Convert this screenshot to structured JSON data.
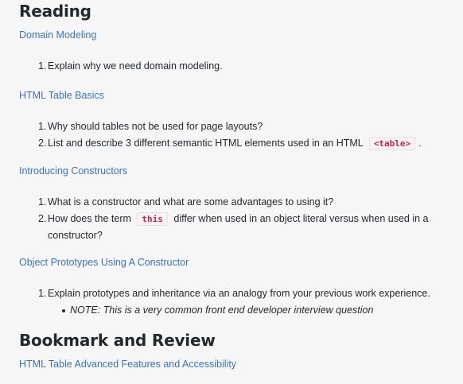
{
  "headings": {
    "reading": "Reading",
    "bookmark": "Bookmark and Review"
  },
  "sections": [
    {
      "link": "Domain Modeling",
      "items": [
        {
          "num": "1.",
          "text": "Explain why we need domain modeling."
        }
      ]
    },
    {
      "link": "HTML Table Basics",
      "items": [
        {
          "num": "1.",
          "text": "Why should tables not be used for page layouts?"
        },
        {
          "num": "2.",
          "before": "List and describe 3 different semantic HTML elements used in an HTML",
          "code": "<table>",
          "after": "."
        }
      ]
    },
    {
      "link": "Introducing Constructors",
      "items": [
        {
          "num": "1.",
          "text": "What is a constructor and what are some advantages to using it?"
        },
        {
          "num": "2.",
          "before": "How does the term",
          "code": "this",
          "after": "differ when used in an object literal versus when used in a constructor?"
        }
      ]
    },
    {
      "link": "Object Prototypes Using A Constructor",
      "items": [
        {
          "num": "1.",
          "text": "Explain prototypes and inheritance via an analogy from your previous work experience.",
          "note": "NOTE: This is a very common front end developer interview question"
        }
      ]
    }
  ],
  "bookmark_links": [
    "HTML Table Advanced Features and Accessibility"
  ]
}
